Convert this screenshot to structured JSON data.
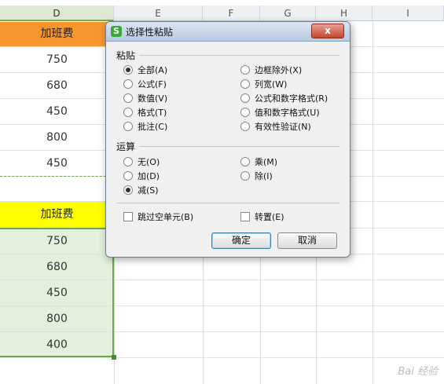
{
  "columns": [
    "D",
    "E",
    "F",
    "G",
    "H",
    "I"
  ],
  "top_table": {
    "header": "加班费",
    "values": [
      "750",
      "680",
      "450",
      "800",
      "450"
    ]
  },
  "bottom_table": {
    "header": "加班费",
    "values": [
      "750",
      "680",
      "450",
      "800",
      "400"
    ]
  },
  "dialog": {
    "title": "选择性粘贴",
    "logo": "S",
    "close": "x",
    "paste_section": "粘贴",
    "paste_left": [
      {
        "label": "全部(A)",
        "checked": true
      },
      {
        "label": "公式(F)",
        "checked": false
      },
      {
        "label": "数值(V)",
        "checked": false
      },
      {
        "label": "格式(T)",
        "checked": false
      },
      {
        "label": "批注(C)",
        "checked": false
      }
    ],
    "paste_right": [
      {
        "label": "边框除外(X)",
        "checked": false
      },
      {
        "label": "列宽(W)",
        "checked": false
      },
      {
        "label": "公式和数字格式(R)",
        "checked": false
      },
      {
        "label": "值和数字格式(U)",
        "checked": false
      },
      {
        "label": "有效性验证(N)",
        "checked": false
      }
    ],
    "op_section": "运算",
    "op_left": [
      {
        "label": "无(O)",
        "checked": false
      },
      {
        "label": "加(D)",
        "checked": false
      },
      {
        "label": "减(S)",
        "checked": true
      }
    ],
    "op_right": [
      {
        "label": "乘(M)",
        "checked": false
      },
      {
        "label": "除(I)",
        "checked": false
      }
    ],
    "skip_blanks": "跳过空单元(B)",
    "transpose": "转置(E)",
    "ok": "确定",
    "cancel": "取消"
  },
  "watermark": "Bai 经验"
}
